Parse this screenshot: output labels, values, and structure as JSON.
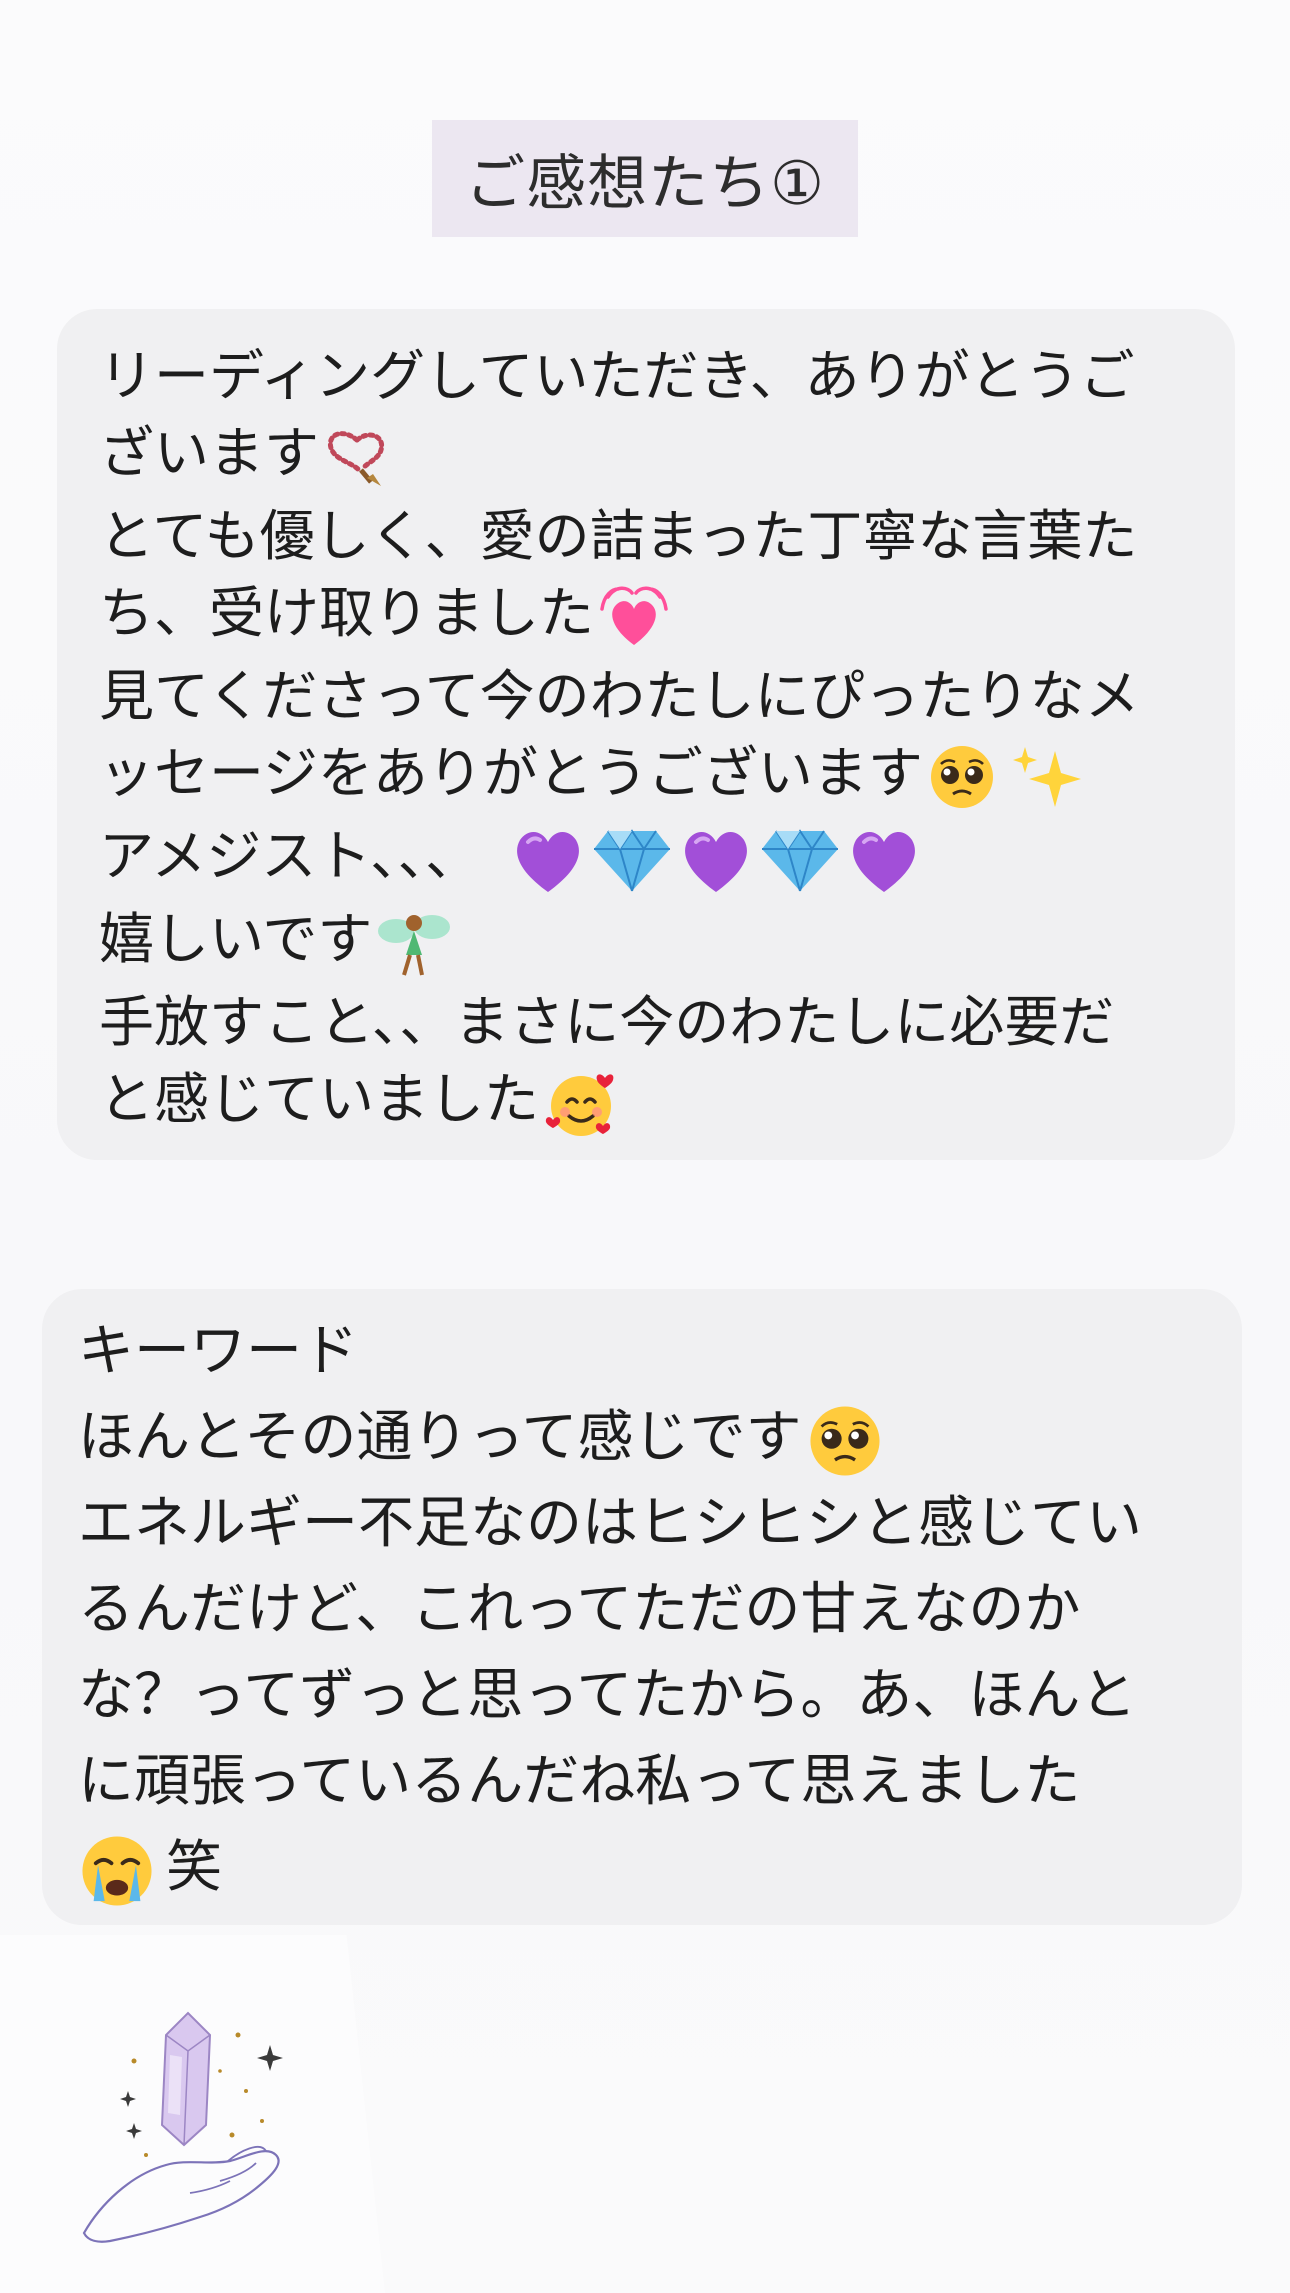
{
  "header": {
    "title": "ご感想たち①"
  },
  "message_1": {
    "lines": [
      "リーディングしていただき、ありがとうご",
      "ざいます",
      "とても優しく、愛の詰まった丁寧な言葉た",
      "ち、受け取りました",
      "見てくださって今のわたしにぴったりなメ",
      "ッセージをありがとうございます",
      "アメジスト、、、",
      "嬉しいです",
      "手放すこと、、まさに今のわたしに必要だ",
      "と感じていました"
    ],
    "emojis": {
      "line2": "prayer-beads-icon",
      "line4": "growing-heart-icon",
      "line6": [
        "pleading-face-icon",
        "sparkles-icon"
      ],
      "line7": [
        "purple-heart-icon",
        "gem-icon",
        "purple-heart-icon",
        "gem-icon",
        "purple-heart-icon"
      ],
      "line8": "fairy-icon",
      "line10": "smiling-face-with-hearts-icon"
    }
  },
  "message_2": {
    "lines": [
      "キーワード",
      "ほんとその通りって感じです",
      "エネルギー不足なのはヒシヒシと感じてい",
      "るんだけど、これってただの甘えなのか",
      "な？ってずっと思ってたから。あ、ほんと",
      "に頑張っているんだね私って思えました",
      "笑"
    ],
    "emojis": {
      "line2": "pleading-face-icon",
      "line7": "crying-face-icon"
    }
  },
  "illustration": {
    "icon": "crystal-in-hand-illustration"
  },
  "colors": {
    "title_bg": "#ece7f1",
    "bubble_bg": "#f0f0f2",
    "purple_heart": "#a24fd8",
    "gem": "#5bb8ea",
    "pink_heart": "#ff4f9a"
  }
}
